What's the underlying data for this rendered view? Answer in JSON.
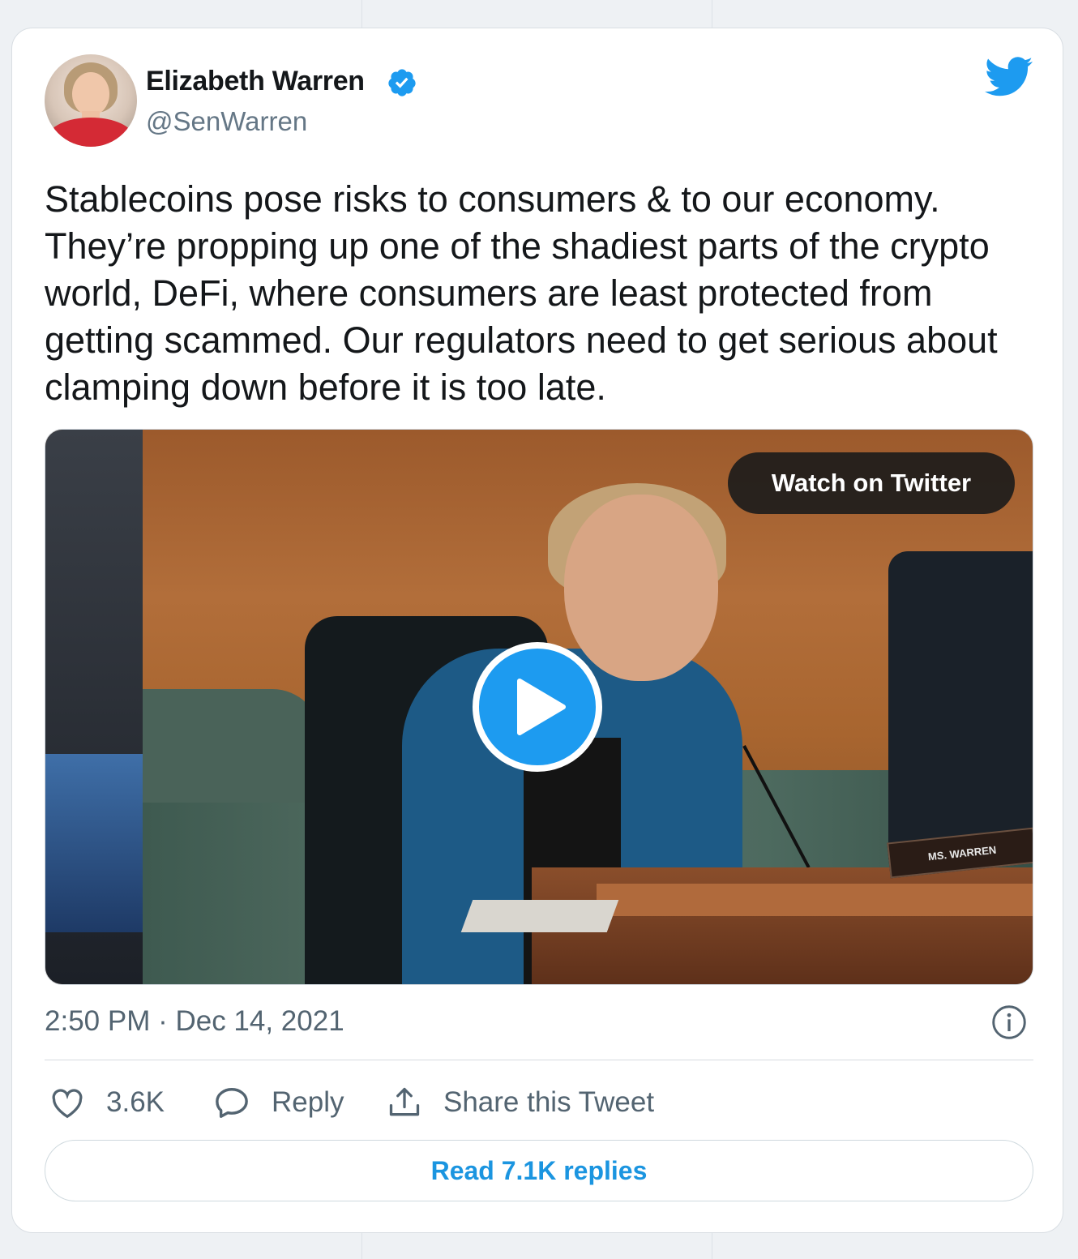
{
  "tweet": {
    "author_name": "Elizabeth Warren",
    "author_handle": "@SenWarren",
    "text": "Stablecoins pose risks to consumers & to our economy. They’re propping up one of the shadiest parts of the crypto world, DeFi, where consumers are least protected from getting scammed. Our regulators need to get serious about clamping down before it is too late.",
    "timestamp": "2:50 PM · Dec 14, 2021"
  },
  "media": {
    "watch_label": "Watch on Twitter",
    "nameplate": "MS. WARREN"
  },
  "actions": {
    "likes_count": "3.6K",
    "reply_label": "Reply",
    "share_label": "Share this Tweet"
  },
  "footer": {
    "read_replies_label": "Read 7.1K replies"
  },
  "icons": {
    "verified": "verified-badge-icon",
    "brand": "twitter-bird-icon",
    "play": "play-icon",
    "info": "info-icon",
    "like": "heart-icon",
    "reply": "speech-bubble-icon",
    "share": "share-upload-icon"
  },
  "colors": {
    "accent": "#1d9bf0",
    "link": "#1b95e0",
    "text_primary": "#14171a",
    "text_secondary": "#536471"
  }
}
